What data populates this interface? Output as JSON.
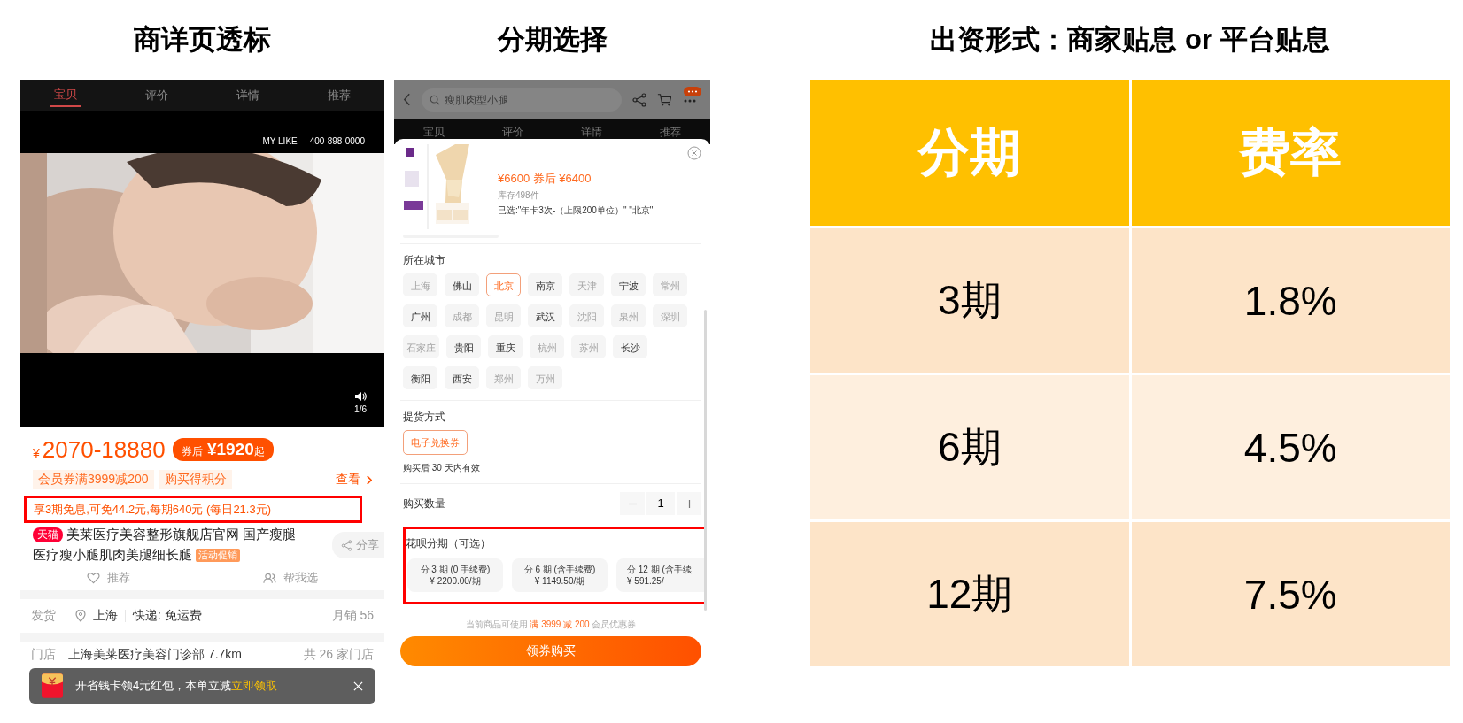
{
  "detail_panel": {
    "title": "商详页透标",
    "tabs": [
      {
        "label": "宝贝",
        "selected": true
      },
      {
        "label": "评价",
        "selected": false
      },
      {
        "label": "详情",
        "selected": false
      },
      {
        "label": "推荐",
        "selected": false
      }
    ],
    "video": {
      "brand": "MY LIKE",
      "phone": "400-898-0000",
      "counter": "1/6"
    },
    "price": {
      "currency": "¥",
      "range": "2070-18880",
      "badge_label": "券后",
      "badge_price": "¥1920",
      "badge_suffix": "起"
    },
    "perks": [
      "会员券满3999减200",
      "购买得积分"
    ],
    "perks_link": "查看",
    "installment_note": "享3期免息,可免44.2元,每期640元 (每日21.3元)",
    "store_tag": "天猫",
    "product_title": [
      "美莱医疗美容整形旗舰店官网 国产瘦腿",
      "医疗瘦小腿肌肉美腿细长腿"
    ],
    "promo_tag": "活动促销",
    "share": "分享",
    "actions": [
      "推荐",
      "帮我选"
    ],
    "shipping": {
      "label": "发货",
      "location": "上海",
      "delivery": "快递: 免运费",
      "sales": "月销 56"
    },
    "store": {
      "label": "门店",
      "name": "上海美莱医疗美容门诊部 7.7km",
      "count": "共 26 家门店"
    },
    "toast": {
      "text": "开省钱卡领4元红包，本单立减",
      "action": "立即领取"
    }
  },
  "select_panel": {
    "title": "分期选择",
    "search": {
      "placeholder": "瘦肌肉型小腿"
    },
    "background_tabs": [
      "宝贝",
      "评价",
      "详情",
      "推荐"
    ],
    "product": {
      "price": "¥6600",
      "after_coupon": "券后 ¥6400",
      "stock": "库存498件",
      "selected_spec": "已选:\"年卡3次-（上限200单位）\" \"北京\""
    },
    "city_label": "所在城市",
    "city_rows": [
      [
        {
          "name": "上海",
          "disabled": true,
          "selected": false
        },
        {
          "name": "佛山",
          "disabled": false,
          "selected": false
        },
        {
          "name": "北京",
          "disabled": false,
          "selected": true
        },
        {
          "name": "南京",
          "disabled": false,
          "selected": false
        },
        {
          "name": "天津",
          "disabled": true,
          "selected": false
        },
        {
          "name": "宁波",
          "disabled": false,
          "selected": false
        },
        {
          "name": "常州",
          "disabled": true,
          "selected": false
        }
      ],
      [
        {
          "name": "广州",
          "disabled": false,
          "selected": false
        },
        {
          "name": "成都",
          "disabled": true,
          "selected": false
        },
        {
          "name": "昆明",
          "disabled": true,
          "selected": false
        },
        {
          "name": "武汉",
          "disabled": false,
          "selected": false
        },
        {
          "name": "沈阳",
          "disabled": true,
          "selected": false
        },
        {
          "name": "泉州",
          "disabled": true,
          "selected": false
        },
        {
          "name": "深圳",
          "disabled": true,
          "selected": false
        }
      ],
      [
        {
          "name": "石家庄",
          "disabled": true,
          "selected": false
        },
        {
          "name": "贵阳",
          "disabled": false,
          "selected": false
        },
        {
          "name": "重庆",
          "disabled": false,
          "selected": false
        },
        {
          "name": "杭州",
          "disabled": true,
          "selected": false
        },
        {
          "name": "苏州",
          "disabled": true,
          "selected": false
        },
        {
          "name": "长沙",
          "disabled": false,
          "selected": false
        }
      ],
      [
        {
          "name": "衡阳",
          "disabled": false,
          "selected": false
        },
        {
          "name": "西安",
          "disabled": false,
          "selected": false
        },
        {
          "name": "郑州",
          "disabled": true,
          "selected": false
        },
        {
          "name": "万州",
          "disabled": true,
          "selected": false
        }
      ]
    ],
    "pickup_label": "提货方式",
    "pickup_options": [
      {
        "label": "电子兑换券",
        "selected": true
      }
    ],
    "pickup_validity": "购买后 30 天内有效",
    "quantity": {
      "label": "购买数量",
      "value": "1"
    },
    "installment_label": "花呗分期（可选）",
    "installments": [
      {
        "title": "分 3 期 (0 手续费)",
        "amount": "¥ 2200.00/期",
        "selected": false
      },
      {
        "title": "分 6 期 (含手续费)",
        "amount": "¥ 1149.50/期",
        "selected": false
      },
      {
        "title": "分 12 期 (含手续",
        "amount": "¥ 591.25/",
        "selected": false
      }
    ],
    "coupon_note": {
      "prefix": "当前商品可使用",
      "highlight": "满 3999 减 200",
      "suffix": "会员优惠券"
    },
    "buy_button": "领券购买"
  },
  "rate_table": {
    "title": "出资形式：商家贴息 or 平台贴息",
    "columns": [
      "分期",
      "费率"
    ],
    "rows": [
      [
        "3期",
        "1.8%"
      ],
      [
        "6期",
        "4.5%"
      ],
      [
        "12期",
        "7.5%"
      ]
    ]
  }
}
